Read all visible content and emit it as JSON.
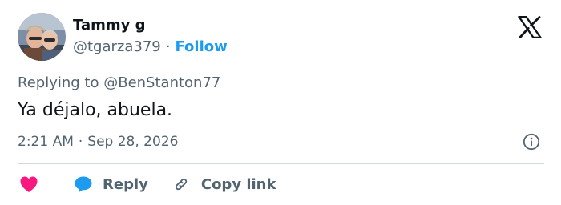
{
  "author": {
    "display_name": "Tammy g",
    "handle": "@tgarza379",
    "separator": "·",
    "follow_label": "Follow"
  },
  "reply_context": {
    "prefix": "Replying to",
    "mention": "@BenStanton77"
  },
  "tweet": {
    "text": "Ya déjalo, abuela.",
    "time": "2:21 AM",
    "separator": "·",
    "date": "Sep 28, 2026"
  },
  "actions": {
    "reply_label": "Reply",
    "copy_link_label": "Copy link"
  },
  "icons": {
    "brand": "x-logo-icon",
    "info": "info-icon",
    "like": "heart-icon",
    "reply": "speech-bubble-icon",
    "copy": "link-icon"
  },
  "colors": {
    "accent": "#1d9bf0",
    "like": "#f91880",
    "reply_icon": "#1d9bf0",
    "muted_text": "#536471",
    "primary_text": "#0f1419",
    "divider": "#cfd9de"
  }
}
